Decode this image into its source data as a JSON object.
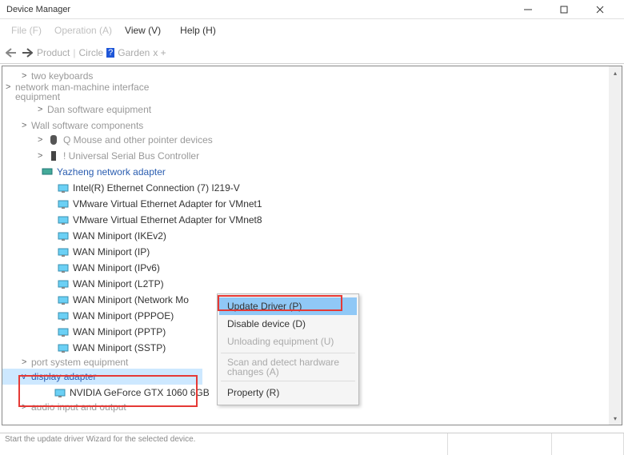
{
  "window": {
    "title": "Device Manager"
  },
  "menu": {
    "file": "File (F)",
    "operation": "Operation (A)",
    "view": "View (V)",
    "help": "Help (H)"
  },
  "toolbar": {
    "product": "Product",
    "circle": "Circle",
    "qmark": "?",
    "garden": "Garden",
    "extra": "x +"
  },
  "tree": {
    "two_keyboards": "two keyboards",
    "network_mmi": "network man-machine interface equipment",
    "dan_software": "Dan software equipment",
    "wall_software": "Wall software components",
    "q_mouse": "Q Mouse and other pointer devices",
    "usb_ctrl": "! Universal Serial Bus Controller",
    "yazheng": "Yazheng network adapter",
    "net_items": [
      "Intel(R) Ethernet Connection (7) I219-V",
      "VMware Virtual Ethernet Adapter for VMnet1",
      "VMware Virtual Ethernet Adapter for VMnet8",
      "WAN Miniport (IKEv2)",
      "WAN Miniport (IP)",
      "WAN Miniport (IPv6)",
      "WAN Miniport (L2TP)",
      "WAN Miniport (Network Mo",
      "WAN Miniport (PPPOE)",
      "WAN Miniport (PPTP)",
      "WAN Miniport (SSTP)"
    ],
    "port_system": "port system equipment",
    "display_adapter": "display adapter",
    "gpu": "NVIDIA GeForce GTX 1060 6GB",
    "audio": "audio input and output"
  },
  "context_menu": {
    "update_driver": "Update Driver (P)",
    "disable": "Disable device (D)",
    "unload": "Unloading equipment (U)",
    "scan": "Scan and detect hardware changes (A)",
    "property": "Property (R)"
  },
  "status": {
    "text": "Start the update driver Wizard for the selected device."
  }
}
